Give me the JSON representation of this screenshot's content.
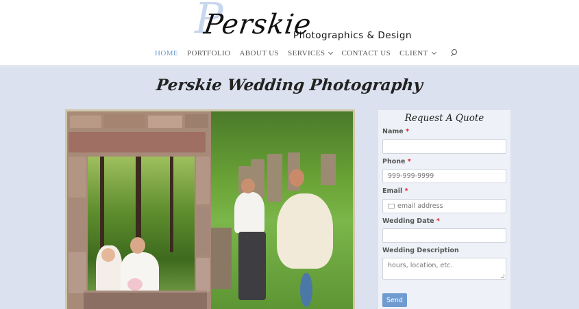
{
  "logo": {
    "initial": "P",
    "script": "Perskie",
    "subtitle": "Photographics & Design"
  },
  "nav": {
    "items": [
      {
        "label": "HOME",
        "active": true
      },
      {
        "label": "PORTFOLIO"
      },
      {
        "label": "ABOUT US"
      },
      {
        "label": "SERVICES",
        "dropdown": true
      },
      {
        "label": "CONTACT US"
      },
      {
        "label": "CLIENT",
        "dropdown": true
      }
    ]
  },
  "main": {
    "title": "Perskie Wedding Photography"
  },
  "form": {
    "title": "Request A Quote",
    "required_mark": "*",
    "fields": {
      "name": {
        "label": "Name",
        "value": "",
        "placeholder": ""
      },
      "phone": {
        "label": "Phone",
        "value": "",
        "placeholder": "999-999-9999"
      },
      "email": {
        "label": "Email",
        "value": "",
        "placeholder": "email address"
      },
      "wedding_date": {
        "label": "Wedding Date",
        "value": "",
        "placeholder": ""
      },
      "description": {
        "label": "Wedding Description",
        "value": "",
        "placeholder": "hours, location, etc."
      }
    },
    "submit_label": "Send"
  },
  "colors": {
    "accent": "#6f9bd1",
    "background": "#dbe1ee",
    "required": "#dd2222"
  }
}
